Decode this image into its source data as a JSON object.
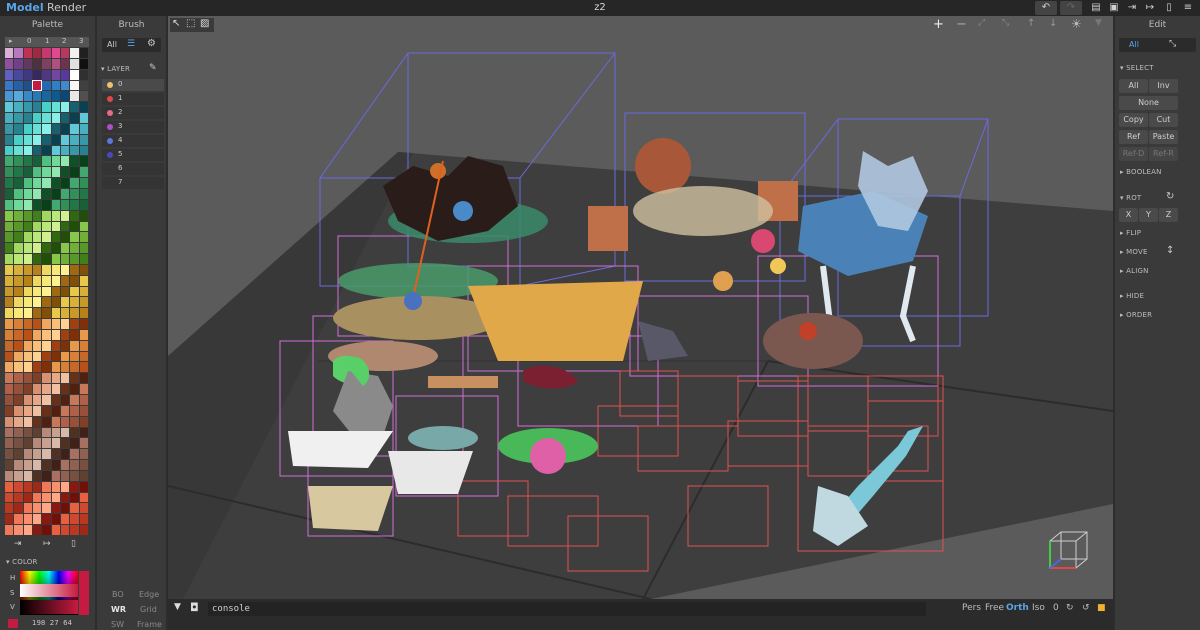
{
  "topbar": {
    "menus": [
      "Model",
      "Render"
    ],
    "title": "z2"
  },
  "palette": {
    "title": "Palette",
    "tabs": [
      "▸",
      "0",
      "1",
      "2",
      "3"
    ],
    "selected_color_index": 30
  },
  "brush": {
    "title": "Brush",
    "filter_all": "All"
  },
  "layers": {
    "header": "LAYER",
    "items": [
      {
        "label": "0",
        "color": "#f0c070",
        "selected": true
      },
      {
        "label": "1",
        "color": "#e04848",
        "selected": false
      },
      {
        "label": "2",
        "color": "#e86a8a",
        "selected": false
      },
      {
        "label": "3",
        "color": "#b050c8",
        "selected": false
      },
      {
        "label": "4",
        "color": "#5a7ad8",
        "selected": false
      },
      {
        "label": "5",
        "color": "#4848b8",
        "selected": false
      },
      {
        "label": "6",
        "color": "",
        "selected": false
      },
      {
        "label": "7",
        "color": "",
        "selected": false
      }
    ]
  },
  "color": {
    "header": "COLOR",
    "h_label": "H",
    "s_label": "S",
    "v_label": "V",
    "rgb": "198  27  64",
    "current_hex": "#c61b40"
  },
  "render_modes": {
    "rows": [
      [
        "BO",
        "Edge"
      ],
      [
        "WR",
        "Grid"
      ],
      [
        "SW",
        "Frame"
      ]
    ],
    "active": "WR"
  },
  "edit": {
    "title": "Edit",
    "all_tab": "All",
    "select_header": "SELECT",
    "select_buttons": [
      "All",
      "Inv"
    ],
    "none_button": "None",
    "copy_buttons": [
      "Copy",
      "Cut"
    ],
    "ref_buttons": [
      "Ref",
      "Paste"
    ],
    "refx_buttons": [
      "Ref-D",
      "Ref-R"
    ],
    "boolean_header": "BOOLEAN",
    "rot_header": "ROT",
    "axis_buttons": [
      "X",
      "Y",
      "Z"
    ],
    "flip_header": "FLIP",
    "move_header": "MOVE",
    "align_header": "ALIGN",
    "hide_header": "HIDE",
    "order_header": "ORDER"
  },
  "console": {
    "value": "console",
    "view_modes": [
      "Pers",
      "Free",
      "Orth",
      "Iso"
    ],
    "active_view": "Orth",
    "counter": "0"
  },
  "colors": {
    "accent": "#5aa4e8",
    "viewport_bg": "#5b5b5b",
    "ground": "#3e3e3e",
    "box_blue": "#6a6ae0",
    "box_pink": "#d070d8",
    "box_red": "#e05050"
  }
}
